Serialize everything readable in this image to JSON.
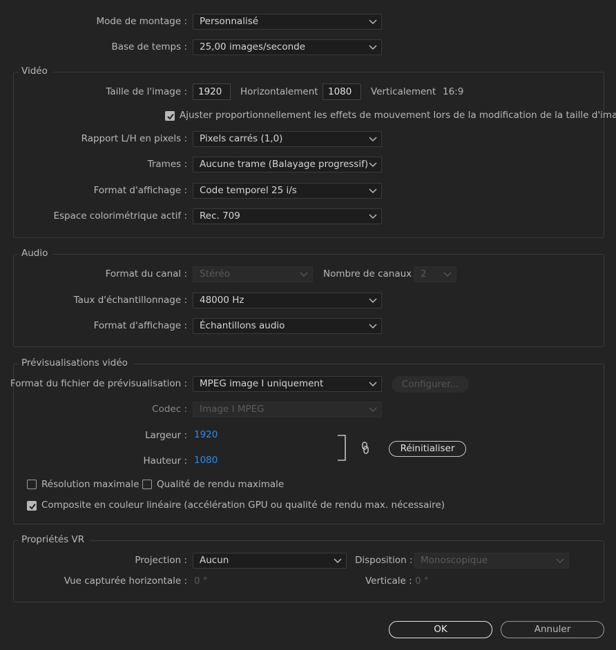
{
  "top": {
    "editing_mode": {
      "label": "Mode de montage :",
      "value": "Personnalisé"
    },
    "timebase": {
      "label": "Base de temps :",
      "value": "25,00  images/seconde"
    }
  },
  "video": {
    "title": "Vidéo",
    "frame_size_label": "Taille de l'image :",
    "width_value": "1920",
    "horizontal_label": "Horizontalement",
    "height_value": "1080",
    "vertical_label": "Verticalement",
    "aspect": "16:9",
    "scale_checkbox": {
      "label": "Ajuster proportionnellement les effets de mouvement lors de la modification de la taille d'image",
      "checked": true
    },
    "pixel_aspect": {
      "label": "Rapport L/H en pixels :",
      "value": "Pixels carrés (1,0)"
    },
    "fields": {
      "label": "Trames :",
      "value": "Aucune trame (Balayage progressif)"
    },
    "display_format": {
      "label": "Format d'affichage :",
      "value": "Code temporel 25 i/s"
    },
    "color_space": {
      "label": "Espace colorimétrique actif :",
      "value": "Rec. 709"
    }
  },
  "audio": {
    "title": "Audio",
    "channel_format": {
      "label": "Format du canal :",
      "value": "Stéréo"
    },
    "num_channels": {
      "label": "Nombre de canaux :",
      "value": "2"
    },
    "sample_rate": {
      "label": "Taux d'échantillonnage :",
      "value": "48000 Hz"
    },
    "display_format": {
      "label": "Format d'affichage :",
      "value": "Échantillons audio"
    }
  },
  "previews": {
    "title": "Prévisualisations vidéo",
    "file_format": {
      "label": "Format du fichier de prévisualisation :",
      "value": "MPEG image I uniquement"
    },
    "configure_label": "Configurer...",
    "codec": {
      "label": "Codec :",
      "value": "Image I MPEG"
    },
    "width": {
      "label": "Largeur :",
      "value": "1920"
    },
    "height": {
      "label": "Hauteur :",
      "value": "1080"
    },
    "reset_label": "Réinitialiser",
    "max_resolution": {
      "label": "Résolution maximale",
      "checked": false
    },
    "max_quality": {
      "label": "Qualité de rendu maximale",
      "checked": false
    },
    "linear_composite": {
      "label": "Composite en couleur linéaire (accélération GPU ou qualité de rendu max. nécessaire)",
      "checked": true
    }
  },
  "vr": {
    "title": "Propriétés VR",
    "projection": {
      "label": "Projection :",
      "value": "Aucun"
    },
    "layout": {
      "label": "Disposition :",
      "value": "Monoscopique"
    },
    "h_view": {
      "label": "Vue capturée horizontale :",
      "value": "0 °"
    },
    "vertical": {
      "label": "Verticale :",
      "value": "0 °"
    }
  },
  "footer": {
    "ok_label": "OK",
    "cancel_label": "Annuler"
  }
}
